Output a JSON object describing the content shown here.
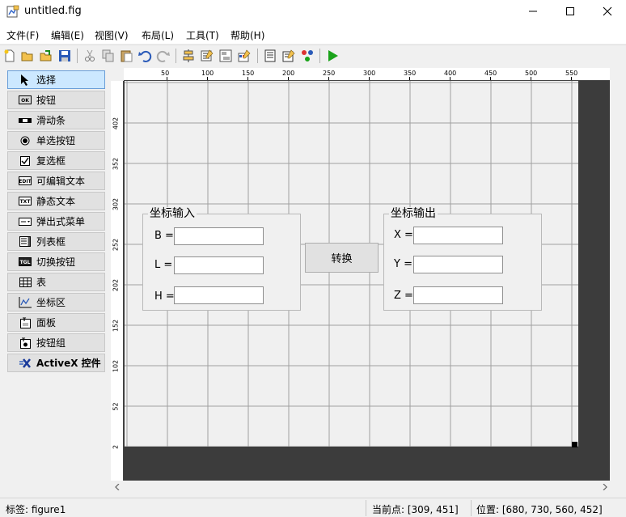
{
  "window": {
    "title": "untitled.fig",
    "minimize_icon": "minimize-icon",
    "maximize_icon": "maximize-icon",
    "close_icon": "close-icon"
  },
  "menu": [
    "文件(F)",
    "编辑(E)",
    "视图(V)",
    "布局(L)",
    "工具(T)",
    "帮助(H)"
  ],
  "toolbar": {
    "icons": [
      "new-icon",
      "open-icon",
      "save-figure-icon",
      "save-icon",
      "cut-icon",
      "copy-icon",
      "paste-icon",
      "undo-icon",
      "redo-icon",
      "align-icon",
      "menu-editor-icon",
      "tab-order-icon",
      "toolbar-editor-icon",
      "editor-icon",
      "property-inspector-icon",
      "object-browser-icon",
      "run-icon"
    ]
  },
  "palette": [
    {
      "label": "选择",
      "icon": "arrow-pointer-icon",
      "selected": true
    },
    {
      "label": "按钮",
      "icon": "pushbutton-icon"
    },
    {
      "label": "滑动条",
      "icon": "slider-icon"
    },
    {
      "label": "单选按钮",
      "icon": "radio-button-icon"
    },
    {
      "label": "复选框",
      "icon": "checkbox-icon"
    },
    {
      "label": "可编辑文本",
      "icon": "edit-text-icon"
    },
    {
      "label": "静态文本",
      "icon": "static-text-icon"
    },
    {
      "label": "弹出式菜单",
      "icon": "popup-menu-icon"
    },
    {
      "label": "列表框",
      "icon": "listbox-icon"
    },
    {
      "label": "切换按钮",
      "icon": "toggle-button-icon"
    },
    {
      "label": "表",
      "icon": "table-icon"
    },
    {
      "label": "坐标区",
      "icon": "axes-icon"
    },
    {
      "label": "面板",
      "icon": "panel-icon"
    },
    {
      "label": "按钮组",
      "icon": "button-group-icon"
    },
    {
      "label": "ActiveX 控件",
      "icon": "activex-icon"
    }
  ],
  "ruler": {
    "top_labels": [
      "50",
      "100",
      "150",
      "200",
      "250",
      "300",
      "350",
      "400",
      "450",
      "500",
      "550"
    ],
    "left_labels": [
      "402",
      "352",
      "302",
      "252",
      "202",
      "152",
      "102",
      "52",
      "2"
    ]
  },
  "figure": {
    "input_panel": {
      "title": "坐标输入",
      "labels": [
        "B =",
        "L =",
        "H ="
      ],
      "values": [
        "",
        "",
        ""
      ]
    },
    "output_panel": {
      "title": "坐标输出",
      "labels": [
        "X =",
        "Y =",
        "Z ="
      ],
      "values": [
        "",
        "",
        ""
      ]
    },
    "convert_button": "转换"
  },
  "status": {
    "tag": "标签: figure1",
    "current_point": "当前点:  [309, 451]",
    "position": "位置: [680, 730, 560, 452]"
  },
  "colors": {
    "selected_bg": "#cce8ff",
    "canvas_bg": "#3c3c3c",
    "grid": "#a0a0a0",
    "run_green": "#1aa31a"
  }
}
